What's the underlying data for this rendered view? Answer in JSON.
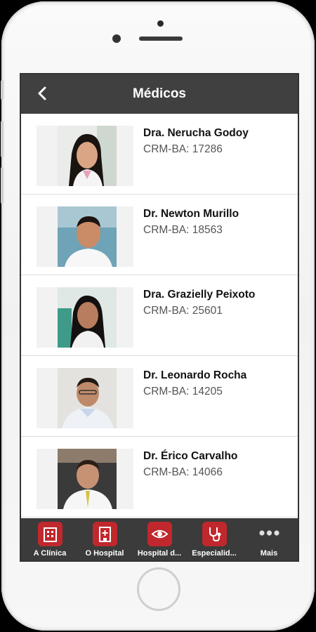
{
  "header": {
    "title": "Médicos",
    "back_icon": "chevron-left-icon"
  },
  "doctors": [
    {
      "name": "Dra. Nerucha Godoy",
      "crm": "CRM-BA: 17286"
    },
    {
      "name": "Dr. Newton Murillo",
      "crm": "CRM-BA: 18563"
    },
    {
      "name": "Dra. Grazielly Peixoto",
      "crm": "CRM-BA: 25601"
    },
    {
      "name": "Dr. Leonardo Rocha",
      "crm": "CRM-BA: 14205"
    },
    {
      "name": "Dr. Érico Carvalho",
      "crm": "CRM-BA: 14066"
    }
  ],
  "tabs": [
    {
      "label": "A Clínica",
      "icon": "clinic-building-icon"
    },
    {
      "label": "O Hospital",
      "icon": "hospital-building-icon"
    },
    {
      "label": "Hospital d...",
      "icon": "eye-icon"
    },
    {
      "label": "Especialid...",
      "icon": "stethoscope-icon"
    },
    {
      "label": "Mais",
      "icon": "more-dots-icon"
    }
  ],
  "colors": {
    "topbar": "#404040",
    "tabbar": "#3b3b3b",
    "tab_icon_bg": "#c0282d"
  }
}
